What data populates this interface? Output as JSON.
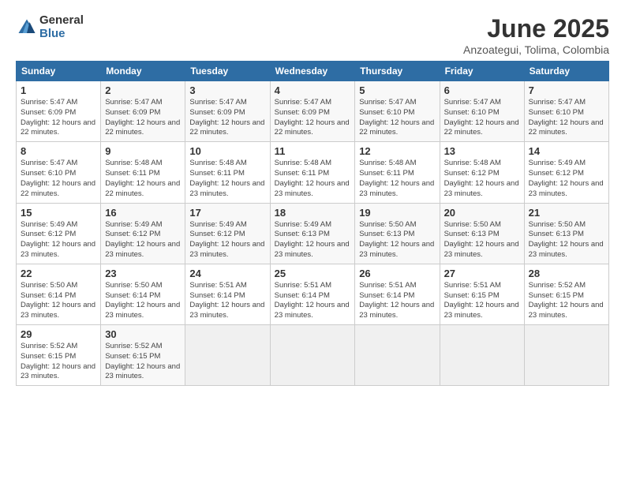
{
  "logo": {
    "general": "General",
    "blue": "Blue"
  },
  "title": {
    "month_year": "June 2025",
    "location": "Anzoategui, Tolima, Colombia"
  },
  "days_of_week": [
    "Sunday",
    "Monday",
    "Tuesday",
    "Wednesday",
    "Thursday",
    "Friday",
    "Saturday"
  ],
  "weeks": [
    [
      {
        "day": "1",
        "sunrise": "5:47 AM",
        "sunset": "6:09 PM",
        "daylight": "12 hours and 22 minutes."
      },
      {
        "day": "2",
        "sunrise": "5:47 AM",
        "sunset": "6:09 PM",
        "daylight": "12 hours and 22 minutes."
      },
      {
        "day": "3",
        "sunrise": "5:47 AM",
        "sunset": "6:09 PM",
        "daylight": "12 hours and 22 minutes."
      },
      {
        "day": "4",
        "sunrise": "5:47 AM",
        "sunset": "6:09 PM",
        "daylight": "12 hours and 22 minutes."
      },
      {
        "day": "5",
        "sunrise": "5:47 AM",
        "sunset": "6:10 PM",
        "daylight": "12 hours and 22 minutes."
      },
      {
        "day": "6",
        "sunrise": "5:47 AM",
        "sunset": "6:10 PM",
        "daylight": "12 hours and 22 minutes."
      },
      {
        "day": "7",
        "sunrise": "5:47 AM",
        "sunset": "6:10 PM",
        "daylight": "12 hours and 22 minutes."
      }
    ],
    [
      {
        "day": "8",
        "sunrise": "5:47 AM",
        "sunset": "6:10 PM",
        "daylight": "12 hours and 22 minutes."
      },
      {
        "day": "9",
        "sunrise": "5:48 AM",
        "sunset": "6:11 PM",
        "daylight": "12 hours and 22 minutes."
      },
      {
        "day": "10",
        "sunrise": "5:48 AM",
        "sunset": "6:11 PM",
        "daylight": "12 hours and 23 minutes."
      },
      {
        "day": "11",
        "sunrise": "5:48 AM",
        "sunset": "6:11 PM",
        "daylight": "12 hours and 23 minutes."
      },
      {
        "day": "12",
        "sunrise": "5:48 AM",
        "sunset": "6:11 PM",
        "daylight": "12 hours and 23 minutes."
      },
      {
        "day": "13",
        "sunrise": "5:48 AM",
        "sunset": "6:12 PM",
        "daylight": "12 hours and 23 minutes."
      },
      {
        "day": "14",
        "sunrise": "5:49 AM",
        "sunset": "6:12 PM",
        "daylight": "12 hours and 23 minutes."
      }
    ],
    [
      {
        "day": "15",
        "sunrise": "5:49 AM",
        "sunset": "6:12 PM",
        "daylight": "12 hours and 23 minutes."
      },
      {
        "day": "16",
        "sunrise": "5:49 AM",
        "sunset": "6:12 PM",
        "daylight": "12 hours and 23 minutes."
      },
      {
        "day": "17",
        "sunrise": "5:49 AM",
        "sunset": "6:12 PM",
        "daylight": "12 hours and 23 minutes."
      },
      {
        "day": "18",
        "sunrise": "5:49 AM",
        "sunset": "6:13 PM",
        "daylight": "12 hours and 23 minutes."
      },
      {
        "day": "19",
        "sunrise": "5:50 AM",
        "sunset": "6:13 PM",
        "daylight": "12 hours and 23 minutes."
      },
      {
        "day": "20",
        "sunrise": "5:50 AM",
        "sunset": "6:13 PM",
        "daylight": "12 hours and 23 minutes."
      },
      {
        "day": "21",
        "sunrise": "5:50 AM",
        "sunset": "6:13 PM",
        "daylight": "12 hours and 23 minutes."
      }
    ],
    [
      {
        "day": "22",
        "sunrise": "5:50 AM",
        "sunset": "6:14 PM",
        "daylight": "12 hours and 23 minutes."
      },
      {
        "day": "23",
        "sunrise": "5:50 AM",
        "sunset": "6:14 PM",
        "daylight": "12 hours and 23 minutes."
      },
      {
        "day": "24",
        "sunrise": "5:51 AM",
        "sunset": "6:14 PM",
        "daylight": "12 hours and 23 minutes."
      },
      {
        "day": "25",
        "sunrise": "5:51 AM",
        "sunset": "6:14 PM",
        "daylight": "12 hours and 23 minutes."
      },
      {
        "day": "26",
        "sunrise": "5:51 AM",
        "sunset": "6:14 PM",
        "daylight": "12 hours and 23 minutes."
      },
      {
        "day": "27",
        "sunrise": "5:51 AM",
        "sunset": "6:15 PM",
        "daylight": "12 hours and 23 minutes."
      },
      {
        "day": "28",
        "sunrise": "5:52 AM",
        "sunset": "6:15 PM",
        "daylight": "12 hours and 23 minutes."
      }
    ],
    [
      {
        "day": "29",
        "sunrise": "5:52 AM",
        "sunset": "6:15 PM",
        "daylight": "12 hours and 23 minutes."
      },
      {
        "day": "30",
        "sunrise": "5:52 AM",
        "sunset": "6:15 PM",
        "daylight": "12 hours and 23 minutes."
      },
      null,
      null,
      null,
      null,
      null
    ]
  ],
  "cell_labels": {
    "sunrise": "Sunrise:",
    "sunset": "Sunset:",
    "daylight": "Daylight:"
  }
}
